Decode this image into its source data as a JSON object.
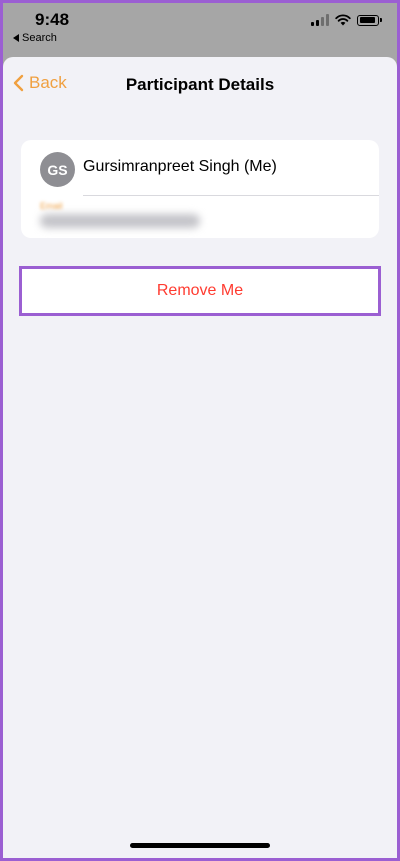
{
  "status_bar": {
    "time": "9:48",
    "back_app_label": "Search",
    "icons": [
      "cellular-signal-icon",
      "wifi-icon",
      "battery-icon"
    ]
  },
  "nav": {
    "back_label": "Back",
    "title": "Participant Details"
  },
  "participant": {
    "initials": "GS",
    "name": "Gursimranpreet Singh (Me)",
    "email_label": "Email",
    "email_value": "redacted"
  },
  "actions": {
    "remove_label": "Remove Me"
  },
  "colors": {
    "accent": "#f0a040",
    "destructive": "#ff3b30",
    "highlight_border": "#9b5fd2",
    "sheet_background": "#f2f2f7",
    "avatar_background": "#8e8e93"
  }
}
